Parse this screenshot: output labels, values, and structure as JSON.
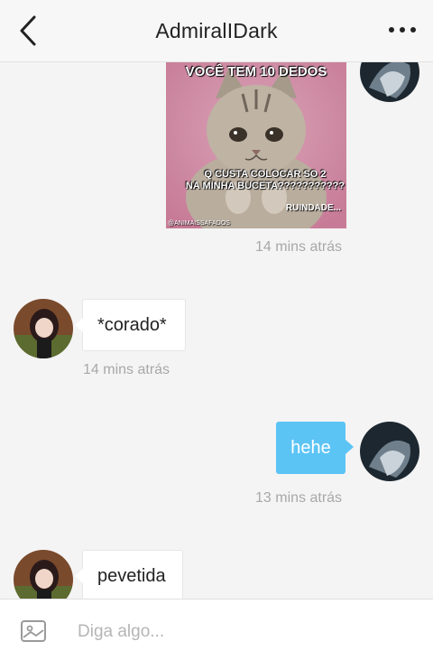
{
  "header": {
    "title": "AdmiralIDark",
    "back_icon": "chevron-left-icon",
    "more_icon": "more-horizontal-icon"
  },
  "meme": {
    "top_text": "VOCÊ TEM 10 DEDOS",
    "middle_text_1": "Q CUSTA COLOCAR SO 2",
    "middle_text_2": "NA MINHA BUCETA???????????",
    "end_text": "RUINDADE...",
    "credit": "@ANIMAISSAFADOS"
  },
  "messages": [
    {
      "direction": "out",
      "type": "image",
      "time": "14 mins atrás"
    },
    {
      "direction": "in",
      "text": "*corado*",
      "time": "14 mins atrás"
    },
    {
      "direction": "out",
      "text": "hehe",
      "time": "13 mins atrás"
    },
    {
      "direction": "in",
      "text": "pevetida"
    }
  ],
  "composer": {
    "placeholder": "Diga algo...",
    "image_icon": "image-icon"
  },
  "colors": {
    "outgoing_bubble": "#5bc4f5",
    "background": "#f4f4f4",
    "timestamp": "#a8a8a8"
  }
}
